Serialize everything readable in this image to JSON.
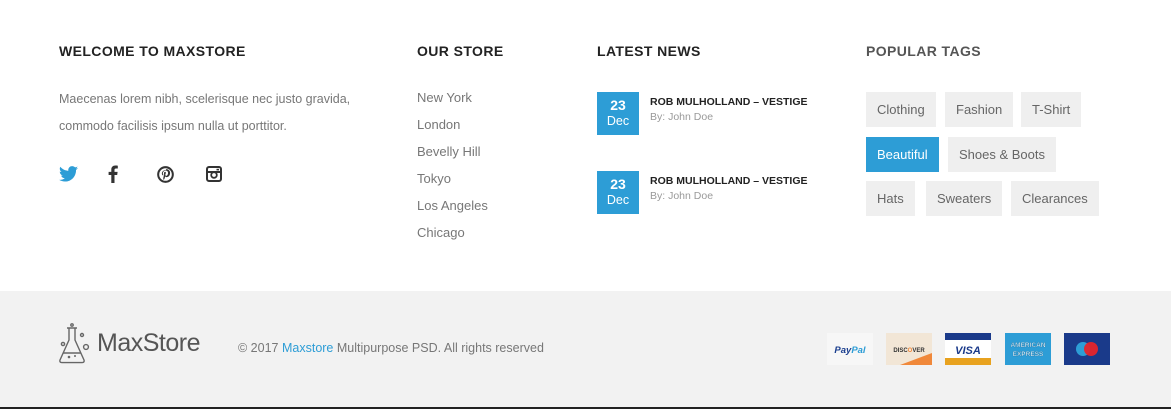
{
  "welcome": {
    "title": "WELCOME TO MAXSTORE",
    "text": "Maecenas lorem nibh, scelerisque nec justo gravida, commodo facilisis ipsum nulla ut porttitor.",
    "socials": [
      "twitter-icon",
      "facebook-icon",
      "pinterest-icon",
      "instagram-icon"
    ]
  },
  "store": {
    "title": "OUR STORE",
    "locations": [
      "New York",
      "London",
      "Bevelly Hill",
      "Tokyo",
      "Los Angeles",
      "Chicago"
    ]
  },
  "news": {
    "title": "LATEST NEWS",
    "items": [
      {
        "day": "23",
        "month": "Dec",
        "title": "ROB MULHOLLAND – VESTIGE",
        "author": "By: John Doe"
      },
      {
        "day": "23",
        "month": "Dec",
        "title": "ROB MULHOLLAND – VESTIGE",
        "author": "By: John Doe"
      }
    ]
  },
  "tags": {
    "title": "POPULAR TAGS",
    "items": [
      {
        "label": "Clothing",
        "active": false
      },
      {
        "label": "Fashion",
        "active": false
      },
      {
        "label": "T-Shirt",
        "active": false
      },
      {
        "label": "Beautiful",
        "active": true
      },
      {
        "label": "Shoes & Boots",
        "active": false
      },
      {
        "label": "Hats",
        "active": false
      },
      {
        "label": "Sweaters",
        "active": false
      },
      {
        "label": "Clearances",
        "active": false
      }
    ]
  },
  "bottom": {
    "logo_text": "MaxStore",
    "copyright_prefix": "© 2017",
    "copyright_link": "Maxstore",
    "copyright_suffix": "Multipurpose PSD. All rights reserved",
    "payments": [
      {
        "name": "paypal-logo",
        "label": "PayPal"
      },
      {
        "name": "discover-logo",
        "label": "DISCOVER"
      },
      {
        "name": "visa-logo",
        "label": "VISA"
      },
      {
        "name": "amex-logo",
        "label": "AMERICAN EXPRESS"
      },
      {
        "name": "maestro-logo",
        "label": ""
      }
    ]
  },
  "colors": {
    "accent": "#2d9dd6",
    "tag_bg": "#efefef",
    "bottom_bg": "#f2f2f2"
  }
}
